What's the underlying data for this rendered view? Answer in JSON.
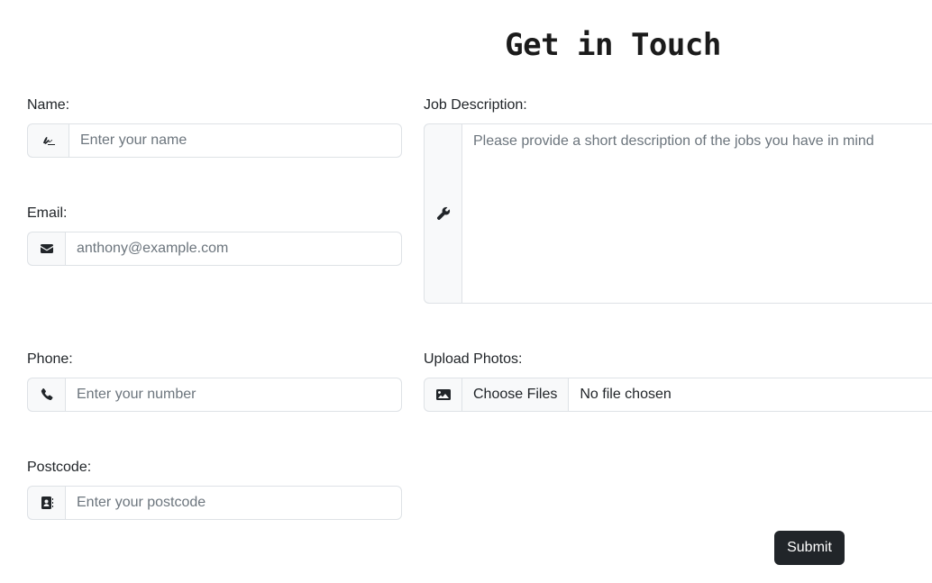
{
  "title": "Get in Touch",
  "fields": {
    "name": {
      "label": "Name:",
      "placeholder": "Enter your name",
      "icon": "signature-icon"
    },
    "email": {
      "label": "Email:",
      "placeholder": "anthony@example.com",
      "icon": "envelope-icon"
    },
    "phone": {
      "label": "Phone:",
      "placeholder": "Enter your number",
      "icon": "phone-icon"
    },
    "postcode": {
      "label": "Postcode:",
      "placeholder": "Enter your postcode",
      "icon": "address-book-icon"
    },
    "job_description": {
      "label": "Job Description:",
      "placeholder": "Please provide a short description of the jobs you have in mind",
      "icon": "wrench-icon"
    },
    "photos": {
      "label": "Upload Photos:",
      "button_label": "Choose Files",
      "status": "No file chosen",
      "icon": "image-icon"
    }
  },
  "submit_label": "Submit",
  "colors": {
    "addon_bg": "#f8f9fa",
    "border": "#dee2e6",
    "button_bg": "#212529",
    "placeholder": "#6c757d"
  }
}
